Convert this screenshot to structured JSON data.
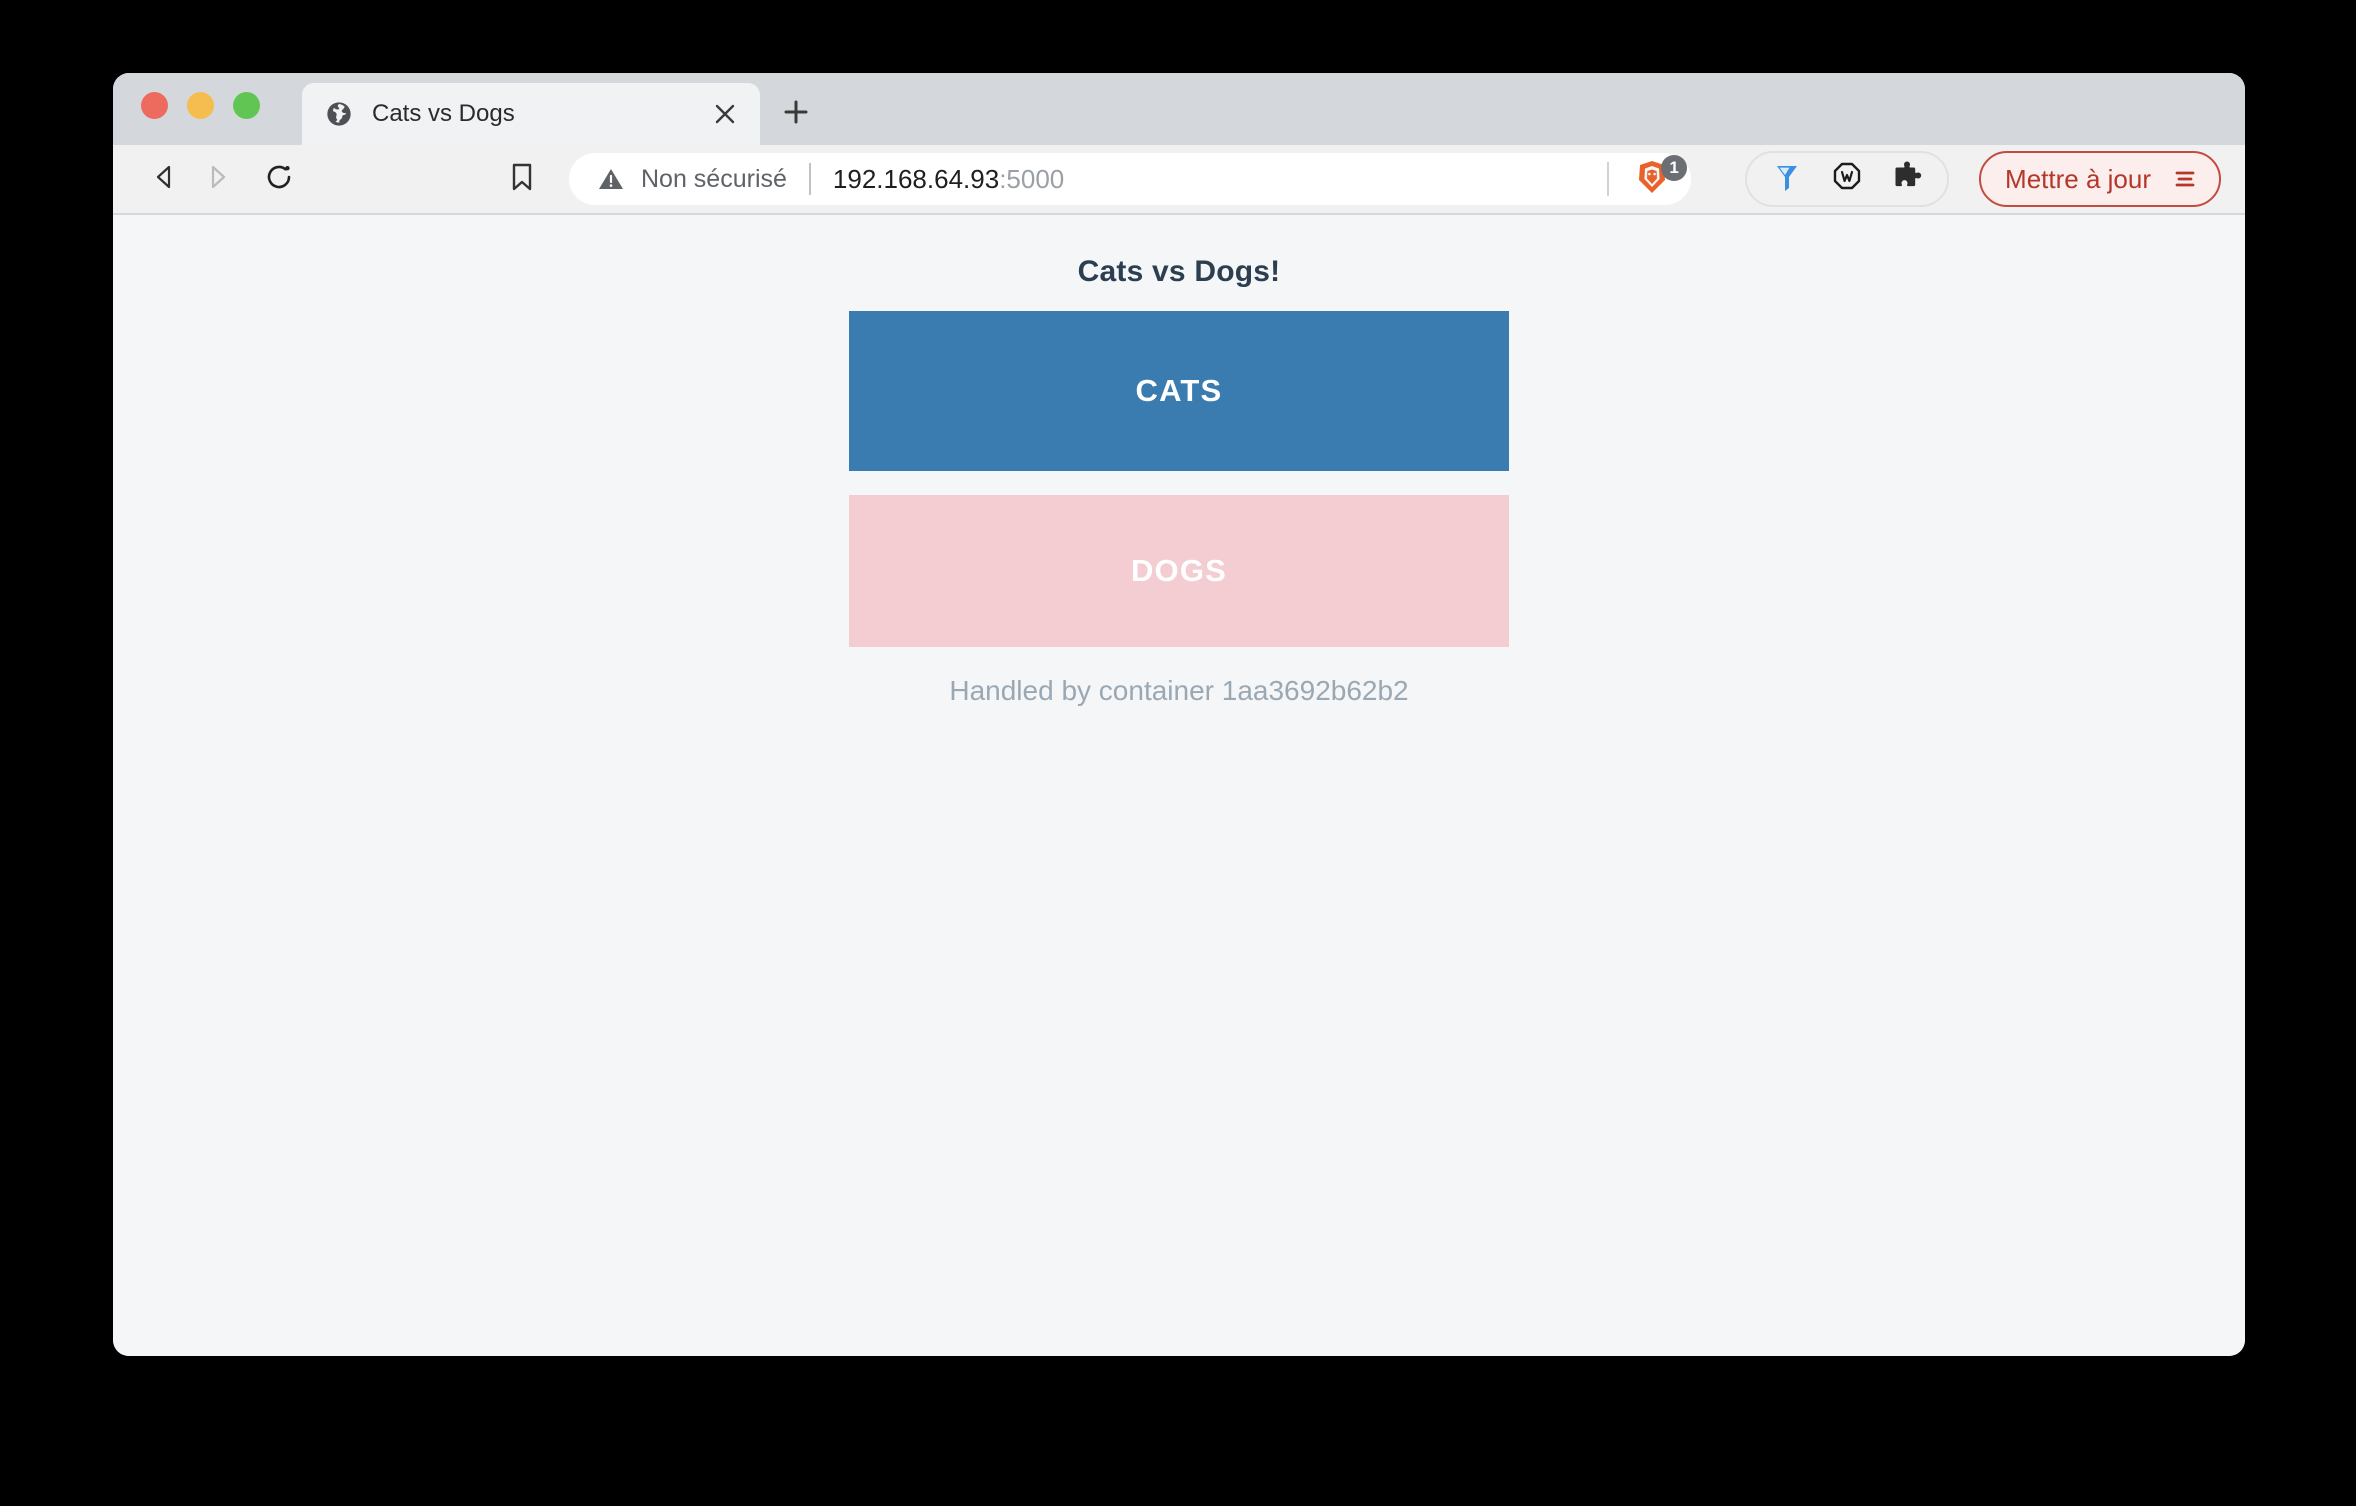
{
  "window": {
    "traffic_lights": [
      {
        "name": "close",
        "color": "#ed6a5e"
      },
      {
        "name": "minimize",
        "color": "#f5bd4f"
      },
      {
        "name": "zoom",
        "color": "#61c554"
      }
    ]
  },
  "tabstrip": {
    "tabs": [
      {
        "title": "Cats vs Dogs",
        "favicon": "globe-icon",
        "close_icon": "close-icon",
        "active": true
      }
    ],
    "new_tab_icon": "plus-icon"
  },
  "toolbar": {
    "back_icon": "back-arrow-icon",
    "forward_icon": "forward-arrow-icon",
    "reload_icon": "reload-icon",
    "bookmark_icon": "bookmark-icon",
    "omnibox": {
      "warning_icon": "warning-triangle-icon",
      "security_text": "Non sécurisé",
      "url_host": "192.168.64.93",
      "url_port": ":5000",
      "full_url": "192.168.64.93:5000"
    },
    "shield": {
      "icon": "brave-shield-lion-icon",
      "badge_count": "1",
      "badge_color": "#6b6f73"
    },
    "extensions": [
      {
        "icon": "funnel-icon",
        "label": ""
      },
      {
        "icon": "octagon-w-icon",
        "label": ""
      },
      {
        "icon": "puzzle-piece-icon",
        "label": ""
      }
    ],
    "update_button": {
      "label": "Mettre à jour",
      "menu_icon": "hamburger-menu-icon",
      "text_color": "#b5372a",
      "border_color": "#c24c3f",
      "background_color": "#fbeeed"
    }
  },
  "page": {
    "title": "Cats vs Dogs!",
    "title_color": "#2c3e50",
    "background_color": "#f5f6f8",
    "vote_bars": [
      {
        "label": "CATS",
        "color": "#3a7cb0",
        "text_color": "#ffffff"
      },
      {
        "label": "DOGS",
        "color": "#f3cdd1",
        "text_color": "#ffffff"
      }
    ],
    "container_note": "Handled by container 1aa3692b62b2",
    "container_note_color": "#9aa8b4"
  }
}
